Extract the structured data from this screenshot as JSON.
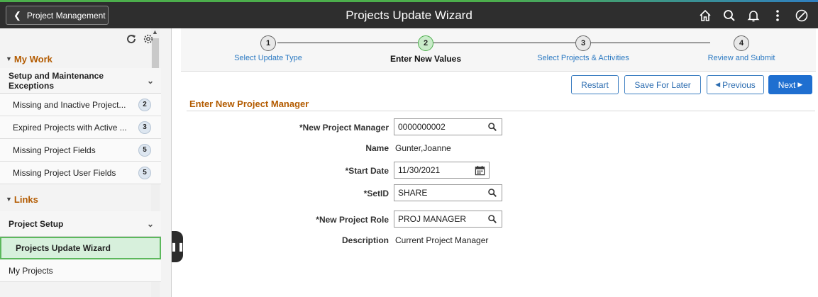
{
  "header": {
    "back_label": "Project Management",
    "title": "Projects Update Wizard",
    "icons": [
      "home-icon",
      "search-icon",
      "bell-icon",
      "actions-menu-icon",
      "navbar-icon"
    ]
  },
  "leftnav": {
    "sections": [
      {
        "title": "My Work",
        "group": "Setup and Maintenance Exceptions",
        "items": [
          {
            "label": "Missing and Inactive Project...",
            "count": "2"
          },
          {
            "label": "Expired Projects with Active ...",
            "count": "3"
          },
          {
            "label": "Missing Project Fields",
            "count": "5"
          },
          {
            "label": "Missing Project User Fields",
            "count": "5"
          }
        ]
      },
      {
        "title": "Links",
        "group": "Project Setup",
        "items": [
          {
            "label": "Projects Update Wizard"
          },
          {
            "label": "My Projects"
          }
        ]
      }
    ]
  },
  "train": {
    "steps": [
      {
        "num": "1",
        "label": "Select Update Type"
      },
      {
        "num": "2",
        "label": "Enter New Values"
      },
      {
        "num": "3",
        "label": "Select Projects & Activities"
      },
      {
        "num": "4",
        "label": "Review and Submit"
      }
    ],
    "current": 2
  },
  "toolbar": {
    "restart": "Restart",
    "save_later": "Save For Later",
    "previous": "Previous",
    "next": "Next"
  },
  "form": {
    "title": "Enter New Project Manager",
    "fields": {
      "manager_label": "*New Project Manager",
      "manager_value": "0000000002",
      "name_label": "Name",
      "name_value": "Gunter,Joanne",
      "start_label": "*Start Date",
      "start_value": "11/30/2021",
      "setid_label": "*SetID",
      "setid_value": "SHARE",
      "role_label": "*New Project Role",
      "role_value": "PROJ MANAGER",
      "desc_label": "Description",
      "desc_value": "Current Project Manager"
    }
  },
  "colors": {
    "header_bg": "#2e2e2e",
    "section_title": "#b35b00",
    "link_blue": "#2b79c2",
    "primary_btn": "#1f6fd0",
    "active_item_bg": "#d7f0dc",
    "active_item_border": "#5cb85c"
  }
}
